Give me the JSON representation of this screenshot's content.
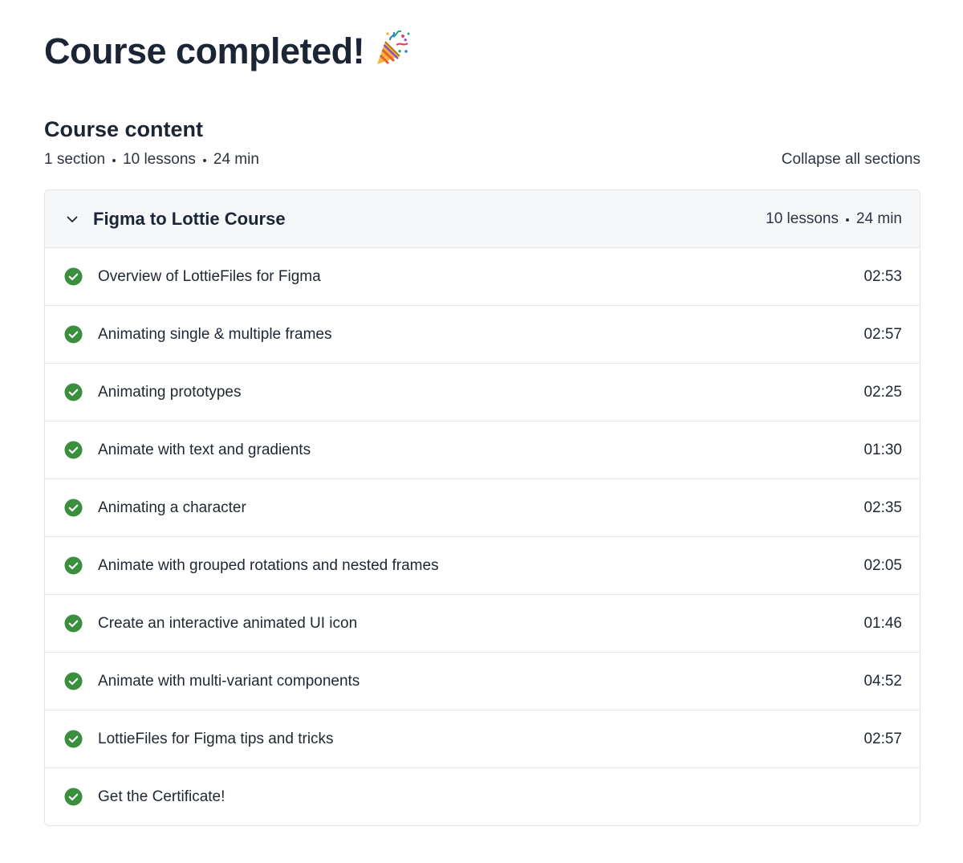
{
  "header": {
    "title": "Course completed!",
    "title_icon": "party-popper-icon"
  },
  "course_content": {
    "heading": "Course content",
    "sections_count": "1 section",
    "lessons_count": "10 lessons",
    "total_duration": "24 min",
    "collapse_label": "Collapse all sections"
  },
  "section": {
    "title": "Figma to Lottie Course",
    "lessons_count": "10 lessons",
    "duration": "24 min",
    "expanded_icon": "chevron-down-icon"
  },
  "lessons": [
    {
      "title": "Overview of LottieFiles for Figma",
      "duration": "02:53",
      "status": "completed"
    },
    {
      "title": "Animating single & multiple frames",
      "duration": "02:57",
      "status": "completed"
    },
    {
      "title": "Animating prototypes",
      "duration": "02:25",
      "status": "completed"
    },
    {
      "title": "Animate with text and gradients",
      "duration": "01:30",
      "status": "completed"
    },
    {
      "title": "Animating a character",
      "duration": "02:35",
      "status": "completed"
    },
    {
      "title": "Animate with grouped rotations and nested frames",
      "duration": "02:05",
      "status": "completed"
    },
    {
      "title": "Create an interactive animated UI icon",
      "duration": "01:46",
      "status": "completed"
    },
    {
      "title": "Animate with multi-variant components",
      "duration": "04:52",
      "status": "completed"
    },
    {
      "title": "LottieFiles for Figma tips and tricks",
      "duration": "02:57",
      "status": "completed"
    },
    {
      "title": "Get the Certificate!",
      "duration": "",
      "status": "completed"
    }
  ],
  "colors": {
    "check_green": "#3a8f3e",
    "text_primary": "#1d2433",
    "header_bg": "#f6f7f9",
    "border": "#e3e5e9"
  }
}
